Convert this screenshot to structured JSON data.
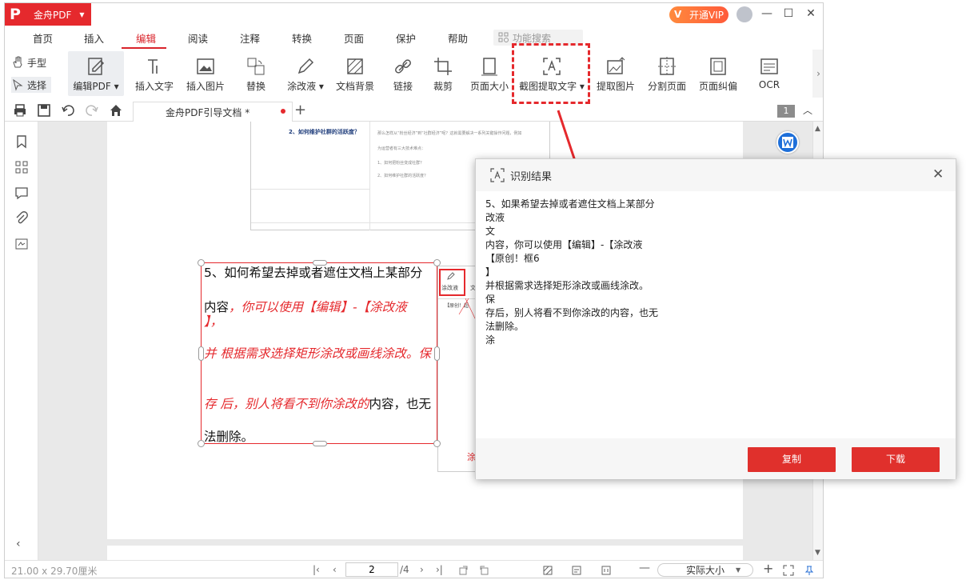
{
  "app": {
    "name": "金舟PDF",
    "vip_label": "开通VIP"
  },
  "menu": {
    "items": [
      "首页",
      "插入",
      "编辑",
      "阅读",
      "注释",
      "转换",
      "页面",
      "保护",
      "帮助"
    ],
    "active": "编辑",
    "search_placeholder": "功能搜索"
  },
  "modes": {
    "hand": "手型",
    "select": "选择"
  },
  "toolbar": {
    "edit_pdf": "编辑PDF",
    "insert_text": "插入文字",
    "insert_image": "插入图片",
    "replace": "替换",
    "whiteout": "涂改液",
    "doc_background": "文档背景",
    "link": "链接",
    "crop": "裁剪",
    "page_size": "页面大小",
    "crop_extract_text": "截图提取文字",
    "extract_image": "提取图片",
    "split_page": "分割页面",
    "deskew": "页面纠偏",
    "ocr": "OCR"
  },
  "tab": {
    "title": "金舟PDF引导文档 *",
    "page_badge": "1"
  },
  "document": {
    "heading2": "2、如何维护社群的活跃度？",
    "para_line1": "那么怎样从“粉丝经济”到“社群经济”呢？这就需要解决一系列关键操作问题，例如",
    "para_line2": "为运营者有三大技术难点：",
    "para_line3": "1、如何把粉丝变成社群？",
    "para_line4": "2、如何维护社群的活跃度？",
    "box_line1": "5、如何希望去掉或者遮住文档上某部分",
    "box_line2_black": "内容",
    "box_line2_red": "，你可以使用【编辑】-【涂改液",
    "box_line3_red": "】，",
    "box_line4_red": "并 根据需求选择矩形涂改或画线涂改。保",
    "box_line5_red": "存 后，别人将看不到你涂改的",
    "box_line5_black": "内容，也无",
    "box_line6": "法删除。",
    "mini_label": "涂改液",
    "mini_label2": "文",
    "mini_caption": "【原创！超",
    "mini_red": "涂"
  },
  "dialog": {
    "title": "识别结果",
    "lines": [
      "5、如果希望去掉或者遮住文档上某部分",
      "改液",
      "文",
      "内容，你可以使用【编辑】-【涂改液",
      "【原创！框6",
      "】",
      "并根据需求选择矩形涂改或画线涂改。",
      "保",
      "存后，别人将看不到你涂改的内容，也无",
      "法删除。",
      "涂"
    ],
    "copy_label": "复制",
    "download_label": "下载"
  },
  "status": {
    "page_dimensions": "21.00 x 29.70厘米",
    "current_page": "2",
    "total_pages": "/4",
    "zoom": "实际大小"
  }
}
